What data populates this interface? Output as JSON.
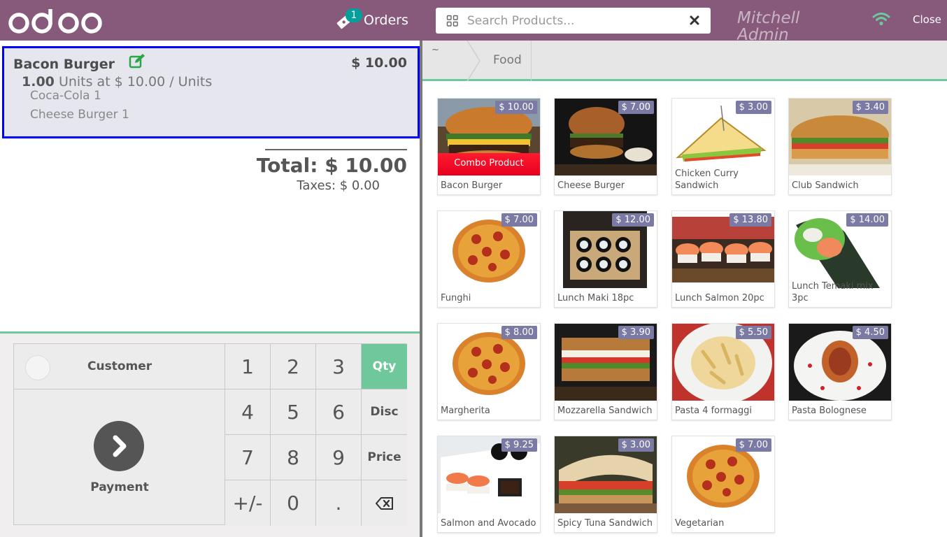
{
  "header": {
    "orders_label": "Orders",
    "orders_count": "1",
    "search_placeholder": "Search Products...",
    "cashier_name": "Mitchell Admin",
    "close_label": "Close",
    "brand_color": "#875a7b"
  },
  "order": {
    "line": {
      "name": "Bacon Burger",
      "price": "$ 10.00",
      "qty": "1.00",
      "qty_suffix": "Units at $ 10.00 / Units",
      "combo_items": [
        "Coca-Cola 1",
        "Cheese Burger 1"
      ]
    },
    "total": "Total: $ 10.00",
    "taxes": "Taxes: $ 0.00"
  },
  "control": {
    "customer_label": "Customer",
    "payment_label": "Payment",
    "keys": [
      {
        "label": "1",
        "name": "numpad-key-1",
        "row": 0,
        "col": 0
      },
      {
        "label": "2",
        "name": "numpad-key-2",
        "row": 0,
        "col": 1
      },
      {
        "label": "3",
        "name": "numpad-key-3",
        "row": 0,
        "col": 2
      },
      {
        "label": "Qty",
        "name": "mode-qty-button",
        "row": 0,
        "col": 3,
        "mode": true,
        "active": true
      },
      {
        "label": "4",
        "name": "numpad-key-4",
        "row": 1,
        "col": 0
      },
      {
        "label": "5",
        "name": "numpad-key-5",
        "row": 1,
        "col": 1
      },
      {
        "label": "6",
        "name": "numpad-key-6",
        "row": 1,
        "col": 2
      },
      {
        "label": "Disc",
        "name": "mode-discount-button",
        "row": 1,
        "col": 3,
        "mode": true
      },
      {
        "label": "7",
        "name": "numpad-key-7",
        "row": 2,
        "col": 0
      },
      {
        "label": "8",
        "name": "numpad-key-8",
        "row": 2,
        "col": 1
      },
      {
        "label": "9",
        "name": "numpad-key-9",
        "row": 2,
        "col": 2
      },
      {
        "label": "Price",
        "name": "mode-price-button",
        "row": 2,
        "col": 3,
        "mode": true
      },
      {
        "label": "+/-",
        "name": "numpad-key-sign",
        "row": 3,
        "col": 0
      },
      {
        "label": "0",
        "name": "numpad-key-0",
        "row": 3,
        "col": 1
      },
      {
        "label": ".",
        "name": "numpad-key-decimal",
        "row": 3,
        "col": 2
      },
      {
        "label": "",
        "name": "backspace-button",
        "row": 3,
        "col": 3,
        "icon": "backspace-icon"
      }
    ],
    "active_color": "#6ec89b"
  },
  "breadcrumbs": {
    "home_label": "~",
    "category_label": "Food"
  },
  "products": [
    {
      "name": "Bacon Burger",
      "price": "$ 10.00",
      "img": "burger",
      "combo": "Combo Product"
    },
    {
      "name": "Cheese Burger",
      "price": "$ 7.00",
      "img": "burger2"
    },
    {
      "name": "Chicken Curry Sandwich",
      "price": "$ 3.00",
      "img": "triangle"
    },
    {
      "name": "Club Sandwich",
      "price": "$ 3.40",
      "img": "club"
    },
    {
      "name": "Funghi",
      "price": "$ 7.00",
      "img": "pizza"
    },
    {
      "name": "Lunch Maki 18pc",
      "price": "$ 12.00",
      "img": "maki"
    },
    {
      "name": "Lunch Salmon 20pc",
      "price": "$ 13.80",
      "img": "salmon"
    },
    {
      "name": "Lunch Temaki mix 3pc",
      "price": "$ 14.00",
      "img": "temaki"
    },
    {
      "name": "Margherita",
      "price": "$ 8.00",
      "img": "pizza"
    },
    {
      "name": "Mozzarella Sandwich",
      "price": "$ 3.90",
      "img": "mozz"
    },
    {
      "name": "Pasta 4 formaggi",
      "price": "$ 5.50",
      "img": "pasta"
    },
    {
      "name": "Pasta Bolognese",
      "price": "$ 4.50",
      "img": "bolognese"
    },
    {
      "name": "Salmon and Avocado",
      "price": "$ 9.25",
      "img": "sushi"
    },
    {
      "name": "Spicy Tuna Sandwich",
      "price": "$ 3.00",
      "img": "panini"
    },
    {
      "name": "Vegetarian",
      "price": "$ 7.00",
      "img": "pizza"
    }
  ]
}
